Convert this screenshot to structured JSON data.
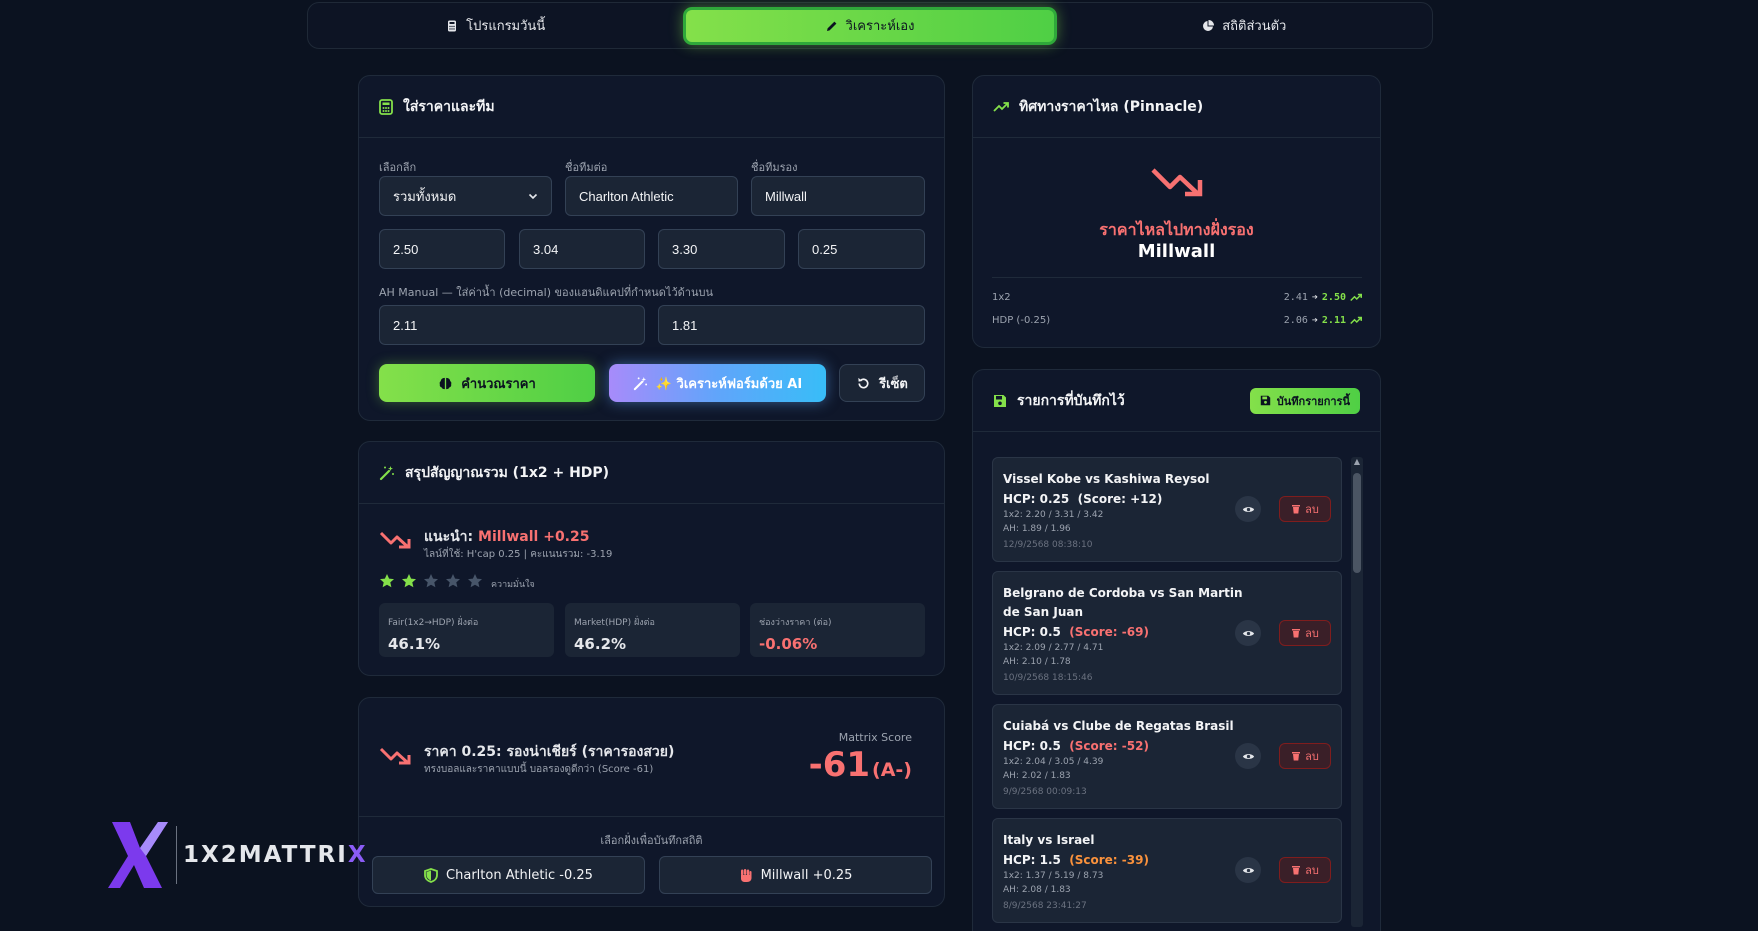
{
  "tabs": [
    {
      "label": "โปรแกรมวันนี้"
    },
    {
      "label": "วิเคราะห์เอง"
    },
    {
      "label": "สถิติส่วนตัว"
    }
  ],
  "input_card": {
    "title": "ใส่ราคาและทีม",
    "league_label": "เลือกลีก",
    "league_value": "รวมทั้งหมด",
    "home_label": "ชื่อทีมต่อ",
    "home_value": "Charlton Athletic",
    "away_label": "ชื่อทีมรอง",
    "away_value": "Millwall",
    "odds": [
      "2.50",
      "3.04",
      "3.30",
      "0.25"
    ],
    "ah_label": "AH Manual — ใส่ค่าน้ำ (decimal) ของแฮนดิแคปที่กำหนดไว้ด้านบน",
    "ah_home": "2.11",
    "ah_away": "1.81",
    "calc_btn": "คำนวณราคา",
    "ai_btn": "✨ วิเคราะห์ฟอร์มด้วย AI",
    "reset_btn": "รีเซ็ต"
  },
  "summary_card": {
    "title": "สรุปสัญญาณรวม (1x2 + HDP)",
    "rec_prefix": "แนะนำ:",
    "rec_value": "Millwall +0.25",
    "rec_sub": "ไลน์ที่ใช้: H'cap 0.25 | คะแนนรวม: -3.19",
    "stars_filled": 2,
    "stars_total": 5,
    "confidence_label": "ความมั่นใจ",
    "stats": [
      {
        "label": "Fair(1x2→HDP) ฝั่งต่อ",
        "value": "46.1%"
      },
      {
        "label": "Market(HDP) ฝั่งต่อ",
        "value": "46.2%"
      },
      {
        "label": "ช่องว่างราคา (ต่อ)",
        "value": "-0.06%"
      }
    ]
  },
  "score_card": {
    "title": "ราคา 0.25: รองน่าเชียร์ (ราคารองสวย)",
    "subtitle": "ทรงบอลและราคาแบบนี้ บอลรองดูดีกว่า (Score -61)",
    "score_label": "Mattrix Score",
    "score_value": "-61",
    "grade": "(A-)",
    "choose_label": "เลือกฝั่งเพื่อบันทึกสถิติ",
    "home_pick": "Charlton Athletic -0.25",
    "away_pick": "Millwall +0.25"
  },
  "trend_card": {
    "title": "ทิศทางราคาไหล (Pinnacle)",
    "direction": "ราคาไหลไปทางฝั่งรอง",
    "team": "Millwall",
    "rows": [
      {
        "label": "1x2",
        "from": "2.41",
        "to": "2.50"
      },
      {
        "label": "HDP (-0.25)",
        "from": "2.06",
        "to": "2.11"
      }
    ]
  },
  "saved_card": {
    "title": "รายการที่บันทึกไว้",
    "save_btn": "บันทึกรายการนี้",
    "delete_label": "ลบ",
    "items": [
      {
        "teams": "Vissel Kobe vs Kashiwa Reysol",
        "hcp": "HCP: 0.25",
        "score": "(Score: +12)",
        "score_color": "#f3f4f6",
        "odds": "1x2: 2.20 / 3.31 / 3.42",
        "ah": "AH: 1.89 / 1.96",
        "date": "12/9/2568 08:38:10"
      },
      {
        "teams": "Belgrano de Cordoba vs San Martin de San Juan",
        "hcp": "HCP: 0.5",
        "score": "(Score: -69)",
        "score_color": "#f87171",
        "odds": "1x2: 2.09 / 2.77 / 4.71",
        "ah": "AH: 2.10 / 1.78",
        "date": "10/9/2568 18:15:46"
      },
      {
        "teams": "Cuiabá vs Clube de Regatas Brasil",
        "hcp": "HCP: 0.5",
        "score": "(Score: -52)",
        "score_color": "#f87171",
        "odds": "1x2: 2.04 / 3.05 / 4.39",
        "ah": "AH: 2.02 / 1.83",
        "date": "9/9/2568 00:09:13"
      },
      {
        "teams": "Italy vs Israel",
        "hcp": "HCP: 1.5",
        "score": "(Score: -39)",
        "score_color": "#fb923c",
        "odds": "1x2: 1.37 / 5.19 / 8.73",
        "ah": "AH: 2.08 / 1.83",
        "date": "8/9/2568 23:41:27"
      }
    ]
  },
  "logo": {
    "text_a": "1X2MATTRI",
    "text_b": "X"
  },
  "colors": {
    "accent": "#84e04a",
    "negative": "#f87171",
    "bg": "#0b1220",
    "card": "#0f172a"
  }
}
